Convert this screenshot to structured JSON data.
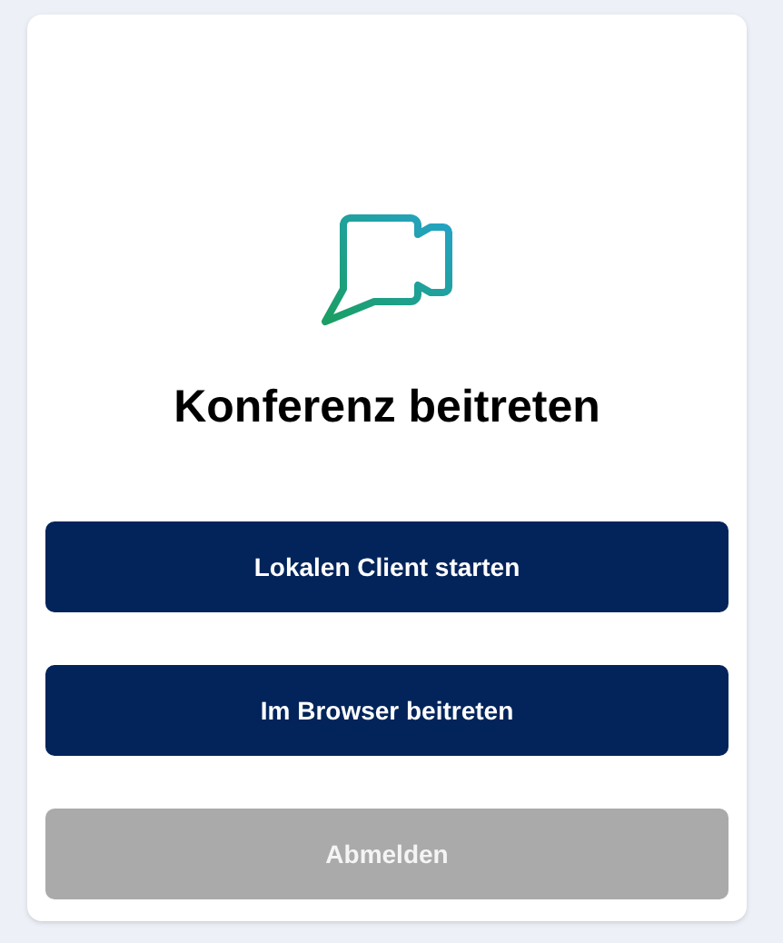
{
  "dialog": {
    "title": "Konferenz beitreten"
  },
  "buttons": [
    {
      "label": "Lokalen Client starten",
      "kind": "primary"
    },
    {
      "label": "Im Browser beitreten",
      "kind": "primary"
    },
    {
      "label": "Abmelden",
      "kind": "secondary"
    }
  ]
}
